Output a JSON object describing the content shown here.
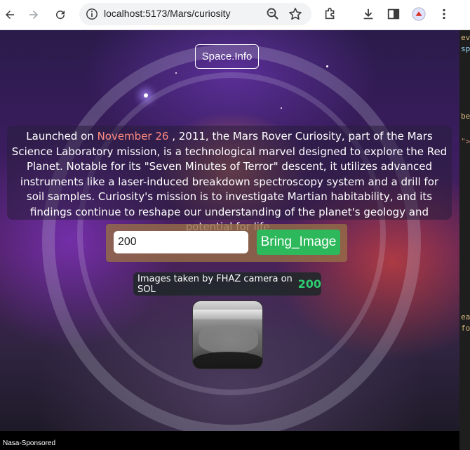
{
  "browser": {
    "url": "localhost:5173/Mars/curiosity"
  },
  "devtools": {
    "snippets": [
      "eve",
      "spa",
      "be",
      "\">",
      "ea",
      "fo"
    ]
  },
  "navbar": {
    "brand": "Space.Info"
  },
  "description": {
    "prefix": "Launched on ",
    "date": "November 26",
    "text": " , 2011, the Mars Rover Curiosity, part of the Mars Science Laboratory mission, is a technological marvel designed to explore the Red Planet. Notable for its \"Seven Minutes of Terror\" descent, it utilizes advanced instruments like a laser-induced breakdown spectroscopy system and a drill for soil samples. Curiosity's mission is to investigate Martian habitability, and its findings continue to reshape our understanding of the planet's geology and potential for life."
  },
  "search": {
    "value": "200",
    "button_label": "Bring_Image"
  },
  "result": {
    "caption": "Images taken by FHAZ camera on SOL",
    "sol": "200"
  },
  "footer": {
    "text": "Nasa-Sponsored"
  },
  "colors": {
    "accent_date": "#ff8a80",
    "button_green": "#2eb85c",
    "sol_green": "#2ecc71"
  }
}
